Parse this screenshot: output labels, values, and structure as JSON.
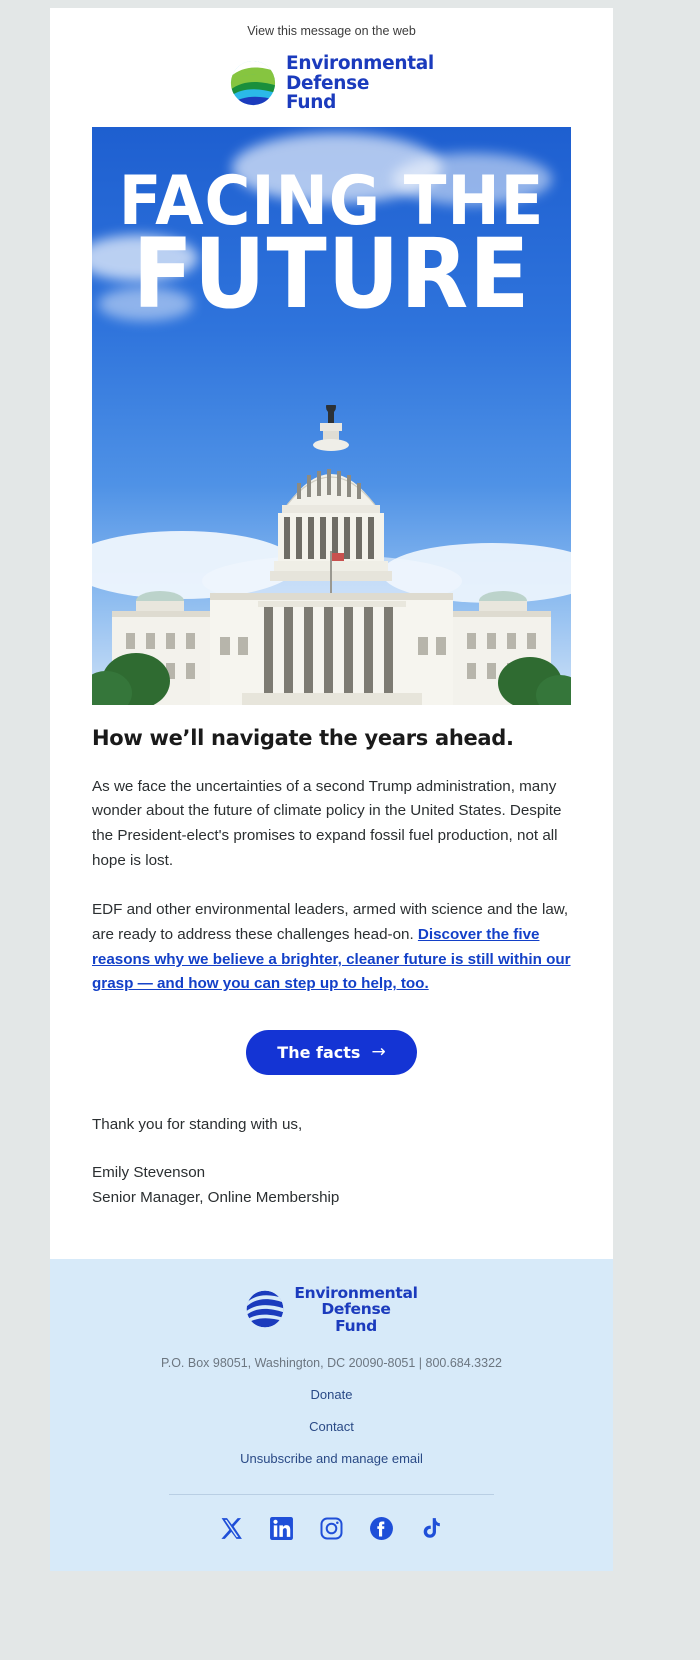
{
  "preheader": {
    "text": "View this message on the web"
  },
  "brand": {
    "name_lines": [
      "Environmental",
      "Defense",
      "Fund"
    ],
    "logo_colors": {
      "cyan": "#2bb9e8",
      "light_green": "#86c540",
      "dark_green": "#1a8f3c",
      "blue": "#1b3bbd"
    },
    "wordmark_color": "#1b3bbd"
  },
  "hero": {
    "title_line1": "FACING THE",
    "title_line2": "FUTURE",
    "image_subject": "us-capitol-building",
    "sky_color": "#2f74dc"
  },
  "content": {
    "headline": "How we’ll navigate the years ahead.",
    "paragraph1": "As we face the uncertainties of a second Trump administration, many wonder about the future of climate policy in the United States. Despite the President-elect's promises to expand fossil fuel production, not all hope is lost.",
    "paragraph2_lead": "EDF and other environmental leaders, armed with science and the law, are ready to address these challenges head-on. ",
    "paragraph2_link": "Discover the five reasons why we believe a brighter, cleaner future is still within our grasp — and how you can step up to help, too.",
    "link_color": "#1340c8"
  },
  "cta": {
    "label": "The facts",
    "arrow": "→",
    "background": "#1434d4",
    "text_color": "#ffffff"
  },
  "signature": {
    "closing": "Thank you for standing with us,",
    "name": "Emily Stevenson",
    "title": "Senior Manager, Online Membership"
  },
  "footer": {
    "background": "#d7eaf9",
    "address": "P.O. Box 98051, Washington, DC 20090-8051 | 800.684.3322",
    "links": [
      {
        "label": "Donate"
      },
      {
        "label": "Contact"
      },
      {
        "label": "Unsubscribe and manage email"
      }
    ],
    "socials": [
      {
        "name": "x-twitter"
      },
      {
        "name": "linkedin"
      },
      {
        "name": "instagram"
      },
      {
        "name": "facebook"
      },
      {
        "name": "tiktok"
      }
    ],
    "social_color": "#1f4fd8"
  }
}
